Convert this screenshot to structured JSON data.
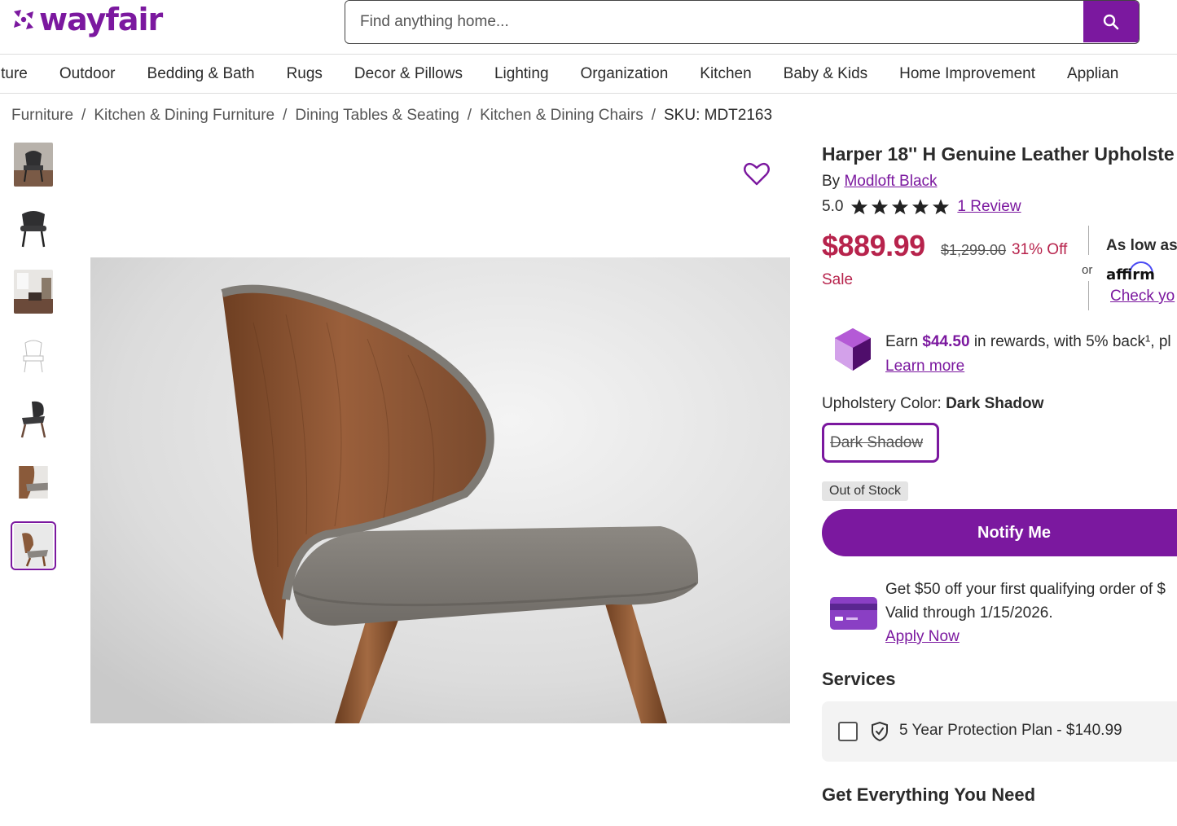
{
  "brand": {
    "name": "wayfair",
    "color": "#7b189f"
  },
  "search": {
    "placeholder": "Find anything home..."
  },
  "nav": [
    "rniture",
    "Outdoor",
    "Bedding & Bath",
    "Rugs",
    "Decor & Pillows",
    "Lighting",
    "Organization",
    "Kitchen",
    "Baby & Kids",
    "Home Improvement",
    "Applian"
  ],
  "breadcrumb": {
    "items": [
      "Furniture",
      "Kitchen & Dining Furniture",
      "Dining Tables & Seating",
      "Kitchen & Dining Chairs"
    ],
    "sku": "SKU: MDT2163"
  },
  "product": {
    "title": "Harper 18'' H Genuine Leather Upholste",
    "by_prefix": "By",
    "brand": "Modloft Black",
    "rating": "5.0",
    "stars": 5,
    "reviews": "1 Review",
    "price": "$889.99",
    "original_price": "$1,299.00",
    "discount": "31% Off",
    "sale_label": "Sale",
    "or": "or",
    "as_low_as": "As low as",
    "affirm": "affirm",
    "check": "Check yo",
    "rewards_prefix": "Earn",
    "rewards_amount": "$44.50",
    "rewards_suffix": "in rewards, with 5% back¹, pl",
    "learn_more": "Learn more",
    "color_label": "Upholstery Color:",
    "color_value": "Dark Shadow",
    "swatch": "Dark Shadow",
    "stock": "Out of Stock",
    "notify": "Notify Me",
    "promo_line1": "Get $50 off your first qualifying order of $",
    "promo_line2": "Valid through 1/15/2026.",
    "apply": "Apply Now",
    "services_heading": "Services",
    "service": "5 Year Protection Plan - $140.99",
    "get_heading": "Get Everything You Need"
  },
  "thumbnails": [
    {
      "name": "thumb-1",
      "active": false
    },
    {
      "name": "thumb-2",
      "active": false
    },
    {
      "name": "thumb-3",
      "active": false
    },
    {
      "name": "thumb-4",
      "active": false
    },
    {
      "name": "thumb-5",
      "active": false
    },
    {
      "name": "thumb-6",
      "active": false
    },
    {
      "name": "thumb-7",
      "active": true
    }
  ],
  "colors": {
    "accent": "#7b189f",
    "sale": "#b7234c"
  }
}
